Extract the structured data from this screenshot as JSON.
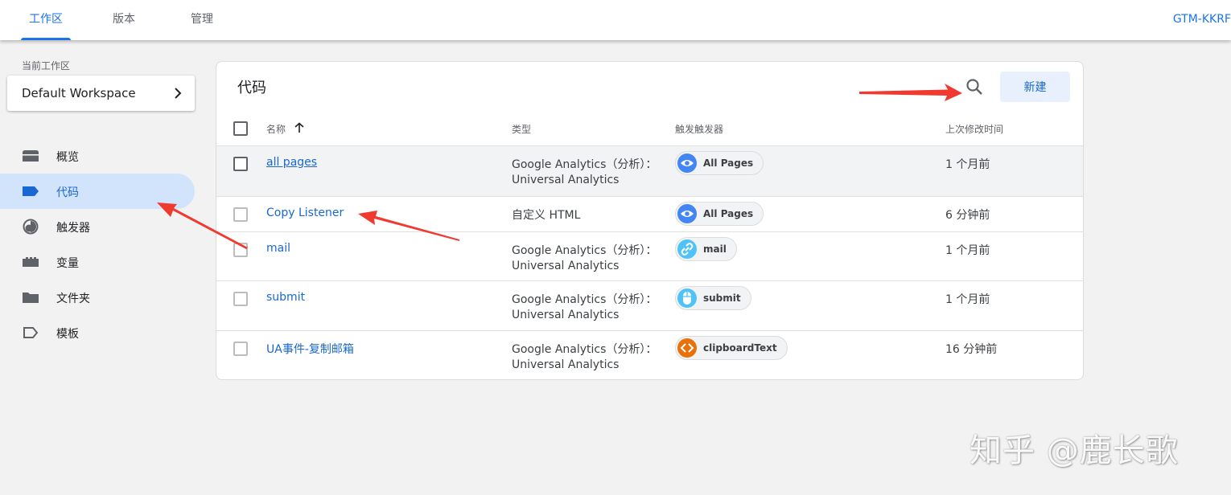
{
  "topbar": {
    "tabs": [
      {
        "label": "工作区",
        "active": true
      },
      {
        "label": "版本",
        "active": false
      },
      {
        "label": "管理",
        "active": false
      }
    ],
    "container_id": "GTM-KKRF"
  },
  "sidebar": {
    "workspace_caption": "当前工作区",
    "workspace_name": "Default Workspace",
    "items": [
      {
        "label": "概览",
        "icon": "overview-icon",
        "active": false
      },
      {
        "label": "代码",
        "icon": "tag-icon",
        "active": true
      },
      {
        "label": "触发器",
        "icon": "trigger-icon",
        "active": false
      },
      {
        "label": "变量",
        "icon": "variable-icon",
        "active": false
      },
      {
        "label": "文件夹",
        "icon": "folder-icon",
        "active": false
      },
      {
        "label": "模板",
        "icon": "template-icon",
        "active": false
      }
    ]
  },
  "main": {
    "title": "代码",
    "new_button": "新建",
    "columns": {
      "name": "名称",
      "type": "类型",
      "triggers": "触发触发器",
      "modified": "上次修改时间"
    },
    "rows": [
      {
        "name": "all pages",
        "type1": "Google Analytics（分析）：",
        "type2": "Universal Analytics",
        "trigger": "All Pages",
        "trigger_icon": "eye-icon",
        "modified": "1 个月前"
      },
      {
        "name": "Copy Listener",
        "type1": "自定义 HTML",
        "type2": "",
        "trigger": "All Pages",
        "trigger_icon": "eye-icon",
        "modified": "6 分钟前"
      },
      {
        "name": "mail",
        "type1": "Google Analytics（分析）：",
        "type2": "Universal Analytics",
        "trigger": "mail",
        "trigger_icon": "link-icon",
        "modified": "1 个月前"
      },
      {
        "name": "submit",
        "type1": "Google Analytics（分析）：",
        "type2": "Universal Analytics",
        "trigger": "submit",
        "trigger_icon": "mouse-click-icon",
        "modified": "1 个月前"
      },
      {
        "name": "UA事件-复制邮箱",
        "type1": "Google Analytics（分析）：",
        "type2": "Universal Analytics",
        "trigger": "clipboardText",
        "trigger_icon": "code-icon",
        "modified": "16 分钟前"
      }
    ]
  },
  "colors": {
    "accent": "#1a73e8",
    "eye_chip": "#4285f4",
    "link_chip": "#4fc3f7",
    "code_chip": "#e8710a",
    "arrow": "#f03a2f"
  },
  "watermark": "知乎 @鹿长歌"
}
